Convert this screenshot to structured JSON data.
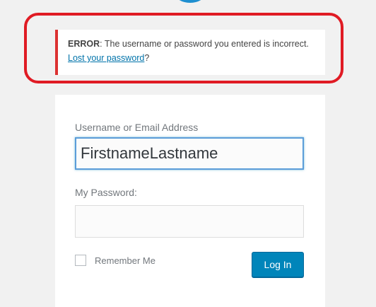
{
  "error": {
    "label": "ERROR",
    "message": ": The username or password you entered is incorrect. ",
    "link_text": "Lost your password",
    "suffix": "?"
  },
  "form": {
    "username_label": "Username or Email Address",
    "username_value": "FirstnameLastname",
    "password_label": "My Password:",
    "password_value": "",
    "remember_label": "Remember Me",
    "remember_checked": false,
    "submit_label": "Log In"
  },
  "colors": {
    "error_border": "#dc3232",
    "highlight_ring": "#e01b24",
    "link": "#0073aa",
    "button": "#0085ba",
    "input_focus": "#5b9dd9",
    "background": "#f1f1f1"
  },
  "icons": {
    "logo": "wordpress-logo-icon"
  }
}
